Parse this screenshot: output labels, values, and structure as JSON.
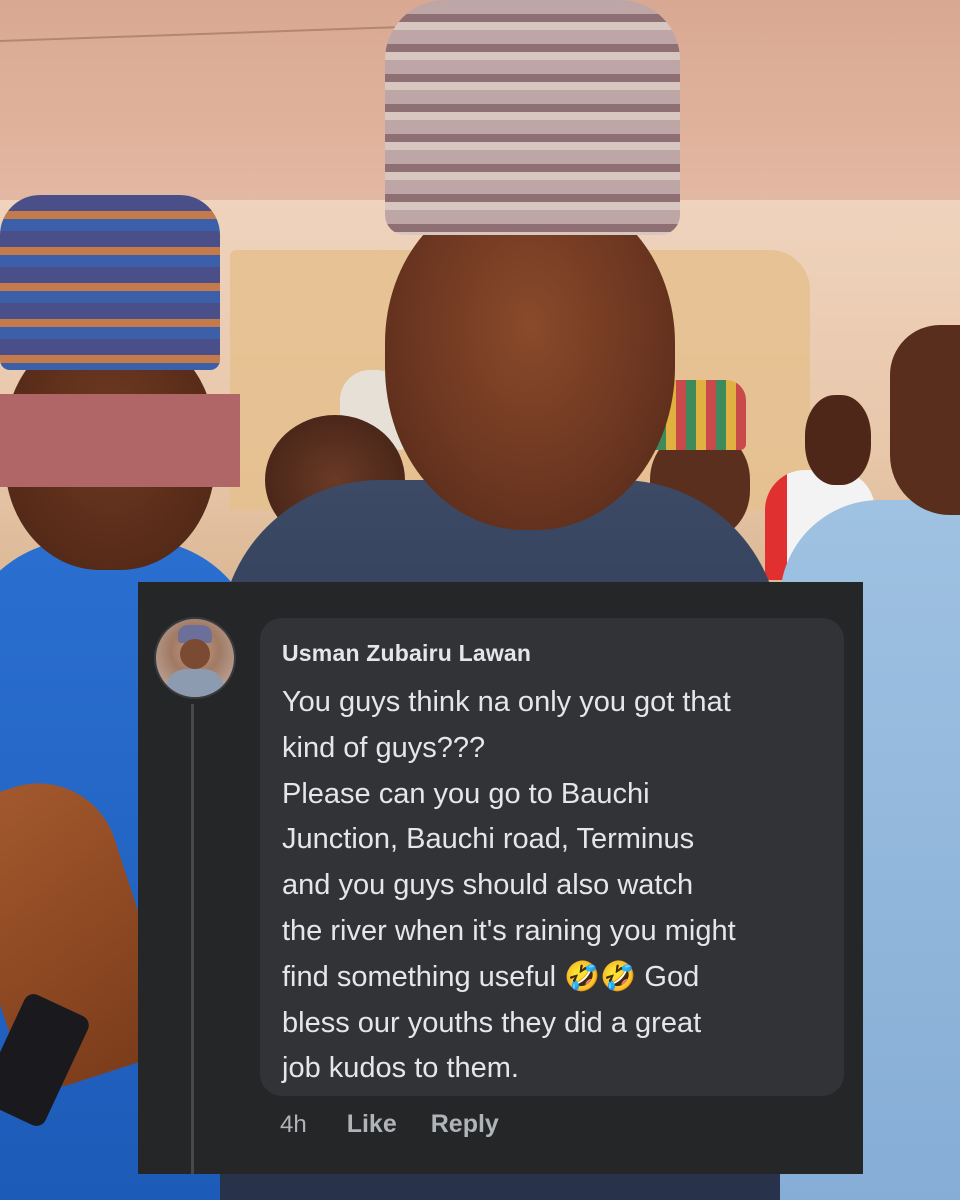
{
  "comment": {
    "author": "Usman Zubairu Lawan",
    "lines": [
      "You guys think na only you got that",
      "kind of guys???",
      "Please can you go to Bauchi",
      "Junction, Bauchi road, Terminus",
      "and you guys should also watch",
      "the river when it's raining you might",
      "find something useful 🤣🤣 God",
      "bless our youths they did a great",
      "job kudos to them."
    ],
    "time": "4h",
    "like_label": "Like",
    "reply_label": "Reply"
  }
}
